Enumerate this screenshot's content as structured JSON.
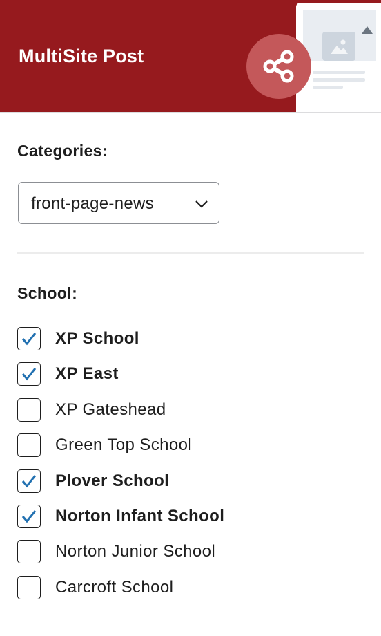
{
  "header": {
    "title": "MultiSite Post",
    "share_icon": "share-icon",
    "preview_icon": "post-preview-icon",
    "colors": {
      "background": "#961a1e",
      "badge": "#c4585a"
    }
  },
  "categories": {
    "label": "Categories:",
    "selected": "front-page-news",
    "chevron_icon": "chevron-down-icon"
  },
  "school": {
    "label": "School:",
    "items": [
      {
        "name": "XP School",
        "checked": true
      },
      {
        "name": "XP East",
        "checked": true
      },
      {
        "name": "XP Gateshead",
        "checked": false
      },
      {
        "name": "Green Top School",
        "checked": false
      },
      {
        "name": "Plover School",
        "checked": true
      },
      {
        "name": "Norton Infant School",
        "checked": true
      },
      {
        "name": "Norton Junior School",
        "checked": false
      },
      {
        "name": "Carcroft School",
        "checked": false
      }
    ],
    "check_color": "#2271b1"
  }
}
